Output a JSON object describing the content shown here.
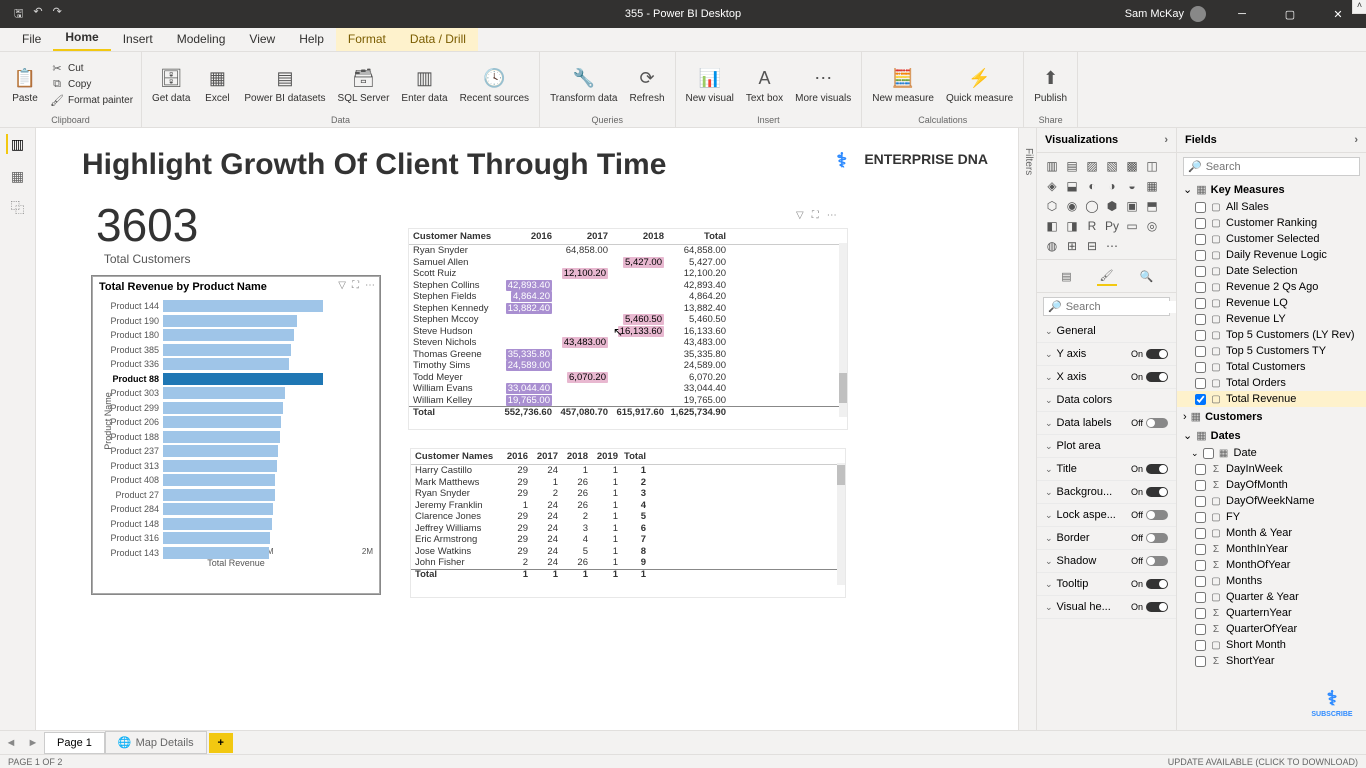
{
  "titlebar": {
    "title": "355 - Power BI Desktop",
    "user": "Sam McKay"
  },
  "tabs": {
    "file": "File",
    "home": "Home",
    "insert": "Insert",
    "modeling": "Modeling",
    "view": "View",
    "help": "Help",
    "format": "Format",
    "datadrill": "Data / Drill"
  },
  "ribbon": {
    "clipboard": {
      "label": "Clipboard",
      "paste": "Paste",
      "cut": "Cut",
      "copy": "Copy",
      "painter": "Format painter"
    },
    "data": {
      "label": "Data",
      "getdata": "Get\ndata",
      "excel": "Excel",
      "pbi": "Power BI\ndatasets",
      "sql": "SQL\nServer",
      "enter": "Enter\ndata",
      "recent": "Recent\nsources"
    },
    "queries": {
      "label": "Queries",
      "transform": "Transform\ndata",
      "refresh": "Refresh"
    },
    "insert": {
      "label": "Insert",
      "newvis": "New\nvisual",
      "textbox": "Text\nbox",
      "more": "More\nvisuals"
    },
    "calc": {
      "label": "Calculations",
      "measure": "New\nmeasure",
      "quick": "Quick\nmeasure"
    },
    "share": {
      "label": "Share",
      "publish": "Publish"
    }
  },
  "filters_label": "Filters",
  "report": {
    "title": "Highlight Growth Of Client Through Time",
    "logo": "ENTERPRISE DNA",
    "kpi_value": "3603",
    "kpi_label": "Total Customers"
  },
  "barchart": {
    "title": "Total Revenue by Product Name",
    "ylabel": "Product Name",
    "xlabel": "Total Revenue",
    "xticks": [
      "0M",
      "1M",
      "2M"
    ],
    "rows": [
      {
        "label": "Product 144",
        "v": 100
      },
      {
        "label": "Product 190",
        "v": 84
      },
      {
        "label": "Product 180",
        "v": 82
      },
      {
        "label": "Product 385",
        "v": 80
      },
      {
        "label": "Product 336",
        "v": 79
      },
      {
        "label": "Product 88",
        "v": 100,
        "hl": true
      },
      {
        "label": "Product 303",
        "v": 76
      },
      {
        "label": "Product 299",
        "v": 75
      },
      {
        "label": "Product 206",
        "v": 74
      },
      {
        "label": "Product 188",
        "v": 73
      },
      {
        "label": "Product 237",
        "v": 72
      },
      {
        "label": "Product 313",
        "v": 71
      },
      {
        "label": "Product 408",
        "v": 70
      },
      {
        "label": "Product 27",
        "v": 70
      },
      {
        "label": "Product 284",
        "v": 69
      },
      {
        "label": "Product 148",
        "v": 68
      },
      {
        "label": "Product 316",
        "v": 67
      },
      {
        "label": "Product 143",
        "v": 66
      }
    ]
  },
  "matrix1": {
    "cols": [
      "Customer Names",
      "2016",
      "2017",
      "2018",
      "Total"
    ],
    "rows": [
      {
        "n": "Ryan Snyder",
        "c": [
          "",
          "64,858.00",
          "",
          "64,858.00"
        ]
      },
      {
        "n": "Samuel Allen",
        "c": [
          "",
          "",
          "5,427.00",
          "5,427.00"
        ],
        "hl": [
          0,
          0,
          2,
          0
        ]
      },
      {
        "n": "Scott Ruiz",
        "c": [
          "",
          "12,100.20",
          "",
          "12,100.20"
        ],
        "hl": [
          0,
          2,
          0,
          0
        ]
      },
      {
        "n": "Stephen Collins",
        "c": [
          "42,893.40",
          "",
          "",
          "42,893.40"
        ],
        "hl": [
          1,
          0,
          0,
          0
        ]
      },
      {
        "n": "Stephen Fields",
        "c": [
          "4,864.20",
          "",
          "",
          "4,864.20"
        ],
        "hl": [
          1,
          0,
          0,
          0
        ]
      },
      {
        "n": "Stephen Kennedy",
        "c": [
          "13,882.40",
          "",
          "",
          "13,882.40"
        ],
        "hl": [
          1,
          0,
          0,
          0
        ]
      },
      {
        "n": "Stephen Mccoy",
        "c": [
          "",
          "",
          "5,460.50",
          "5,460.50"
        ],
        "hl": [
          0,
          0,
          2,
          0
        ]
      },
      {
        "n": "Steve Hudson",
        "c": [
          "",
          "",
          "16,133.60",
          "16,133.60"
        ],
        "hl": [
          0,
          0,
          2,
          0
        ]
      },
      {
        "n": "Steven Nichols",
        "c": [
          "",
          "43,483.00",
          "",
          "43,483.00"
        ],
        "hl": [
          0,
          2,
          0,
          0
        ]
      },
      {
        "n": "Thomas Greene",
        "c": [
          "35,335.80",
          "",
          "",
          "35,335.80"
        ],
        "hl": [
          1,
          0,
          0,
          0
        ]
      },
      {
        "n": "Timothy Sims",
        "c": [
          "24,589.00",
          "",
          "",
          "24,589.00"
        ],
        "hl": [
          1,
          0,
          0,
          0
        ]
      },
      {
        "n": "Todd Meyer",
        "c": [
          "",
          "6,070.20",
          "",
          "6,070.20"
        ],
        "hl": [
          0,
          2,
          0,
          0
        ]
      },
      {
        "n": "William Evans",
        "c": [
          "33,044.40",
          "",
          "",
          "33,044.40"
        ],
        "hl": [
          1,
          0,
          0,
          0
        ]
      },
      {
        "n": "William Kelley",
        "c": [
          "19,765.00",
          "",
          "",
          "19,765.00"
        ],
        "hl": [
          1,
          0,
          0,
          0
        ]
      }
    ],
    "total": {
      "n": "Total",
      "c": [
        "552,736.60",
        "457,080.70",
        "615,917.60",
        "1,625,734.90"
      ]
    }
  },
  "matrix2": {
    "cols": [
      "Customer Names",
      "2016",
      "2017",
      "2018",
      "2019",
      "Total"
    ],
    "rows": [
      {
        "n": "Harry Castillo",
        "c": [
          "29",
          "24",
          "1",
          "1",
          "1"
        ]
      },
      {
        "n": "Mark Matthews",
        "c": [
          "29",
          "1",
          "26",
          "1",
          "2"
        ]
      },
      {
        "n": "Ryan Snyder",
        "c": [
          "29",
          "2",
          "26",
          "1",
          "3"
        ]
      },
      {
        "n": "Jeremy Franklin",
        "c": [
          "1",
          "24",
          "26",
          "1",
          "4"
        ]
      },
      {
        "n": "Clarence Jones",
        "c": [
          "29",
          "24",
          "2",
          "1",
          "5"
        ]
      },
      {
        "n": "Jeffrey Williams",
        "c": [
          "29",
          "24",
          "3",
          "1",
          "6"
        ]
      },
      {
        "n": "Eric Armstrong",
        "c": [
          "29",
          "24",
          "4",
          "1",
          "7"
        ]
      },
      {
        "n": "Jose Watkins",
        "c": [
          "29",
          "24",
          "5",
          "1",
          "8"
        ]
      },
      {
        "n": "John Fisher",
        "c": [
          "2",
          "24",
          "26",
          "1",
          "9"
        ]
      }
    ],
    "total": {
      "n": "Total",
      "c": [
        "1",
        "1",
        "1",
        "1",
        "1"
      ]
    }
  },
  "viz_pane": {
    "title": "Visualizations",
    "search_ph": "Search",
    "general": "General"
  },
  "format_props": [
    {
      "name": "Y axis",
      "state": "On"
    },
    {
      "name": "X axis",
      "state": "On"
    },
    {
      "name": "Data colors",
      "state": null
    },
    {
      "name": "Data labels",
      "state": "Off"
    },
    {
      "name": "Plot area",
      "state": null
    },
    {
      "name": "Title",
      "state": "On"
    },
    {
      "name": "Backgrou...",
      "state": "On"
    },
    {
      "name": "Lock aspe...",
      "state": "Off"
    },
    {
      "name": "Border",
      "state": "Off"
    },
    {
      "name": "Shadow",
      "state": "Off"
    },
    {
      "name": "Tooltip",
      "state": "On"
    },
    {
      "name": "Visual he...",
      "state": "On"
    }
  ],
  "fields_pane": {
    "title": "Fields",
    "search_ph": "Search"
  },
  "field_tables": [
    {
      "name": "Key Measures",
      "open": true,
      "icon": "▦",
      "items": [
        {
          "name": "All Sales"
        },
        {
          "name": "Customer Ranking"
        },
        {
          "name": "Customer Selected"
        },
        {
          "name": "Daily Revenue Logic"
        },
        {
          "name": "Date Selection"
        },
        {
          "name": "Revenue 2 Qs Ago"
        },
        {
          "name": "Revenue LQ"
        },
        {
          "name": "Revenue LY"
        },
        {
          "name": "Top 5 Customers (LY Rev)"
        },
        {
          "name": "Top 5 Customers TY"
        },
        {
          "name": "Total Customers"
        },
        {
          "name": "Total Orders"
        },
        {
          "name": "Total Revenue",
          "checked": true
        }
      ]
    },
    {
      "name": "Customers",
      "open": false,
      "icon": "▦"
    },
    {
      "name": "Dates",
      "open": true,
      "icon": "▦",
      "items": [
        {
          "name": "Date",
          "icon": "▦",
          "sub": true
        },
        {
          "name": "DayInWeek",
          "icon": "Σ"
        },
        {
          "name": "DayOfMonth",
          "icon": "Σ"
        },
        {
          "name": "DayOfWeekName"
        },
        {
          "name": "FY"
        },
        {
          "name": "Month & Year"
        },
        {
          "name": "MonthInYear",
          "icon": "Σ"
        },
        {
          "name": "MonthOfYear",
          "icon": "Σ"
        },
        {
          "name": "Months"
        },
        {
          "name": "Quarter & Year"
        },
        {
          "name": "QuarternYear",
          "icon": "Σ"
        },
        {
          "name": "QuarterOfYear",
          "icon": "Σ"
        },
        {
          "name": "Short Month"
        },
        {
          "name": "ShortYear",
          "icon": "Σ"
        }
      ]
    }
  ],
  "pagetabs": {
    "p1": "Page 1",
    "p2": "Map Details"
  },
  "statusbar": {
    "left": "PAGE 1 OF 2",
    "right": "UPDATE AVAILABLE (CLICK TO DOWNLOAD)"
  },
  "subscribe": "SUBSCRIBE"
}
